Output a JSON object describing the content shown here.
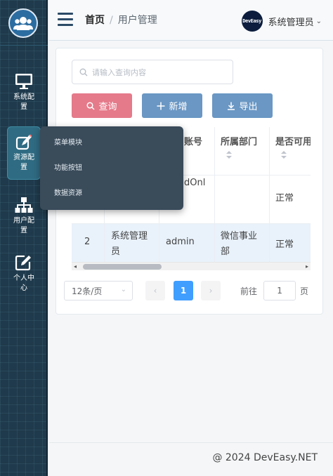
{
  "sidebar": {
    "items": [
      {
        "label": "系统配置",
        "icon": "monitor-icon"
      },
      {
        "label": "资源配置",
        "icon": "pen-icon",
        "active": true
      },
      {
        "label": "用户配置",
        "icon": "org-chart-icon"
      },
      {
        "label": "个人中心",
        "icon": "edit-icon"
      }
    ],
    "submenu": [
      "菜单模块",
      "功能按钮",
      "数据资源"
    ]
  },
  "header": {
    "breadcrumb_home": "首页",
    "breadcrumb_sep": "/",
    "breadcrumb_current": "用户管理",
    "avatar_text": "DevEasy",
    "username": "系统管理员",
    "caret": "⌄"
  },
  "toolbar": {
    "search_placeholder": "请输入查询内容",
    "query_label": "查询",
    "add_label": "新增",
    "export_label": "导出"
  },
  "table": {
    "headers": [
      "账号",
      "所属部门",
      "是否可用"
    ],
    "header_partial": [
      "账号",
      "所属部门",
      "是否可用"
    ],
    "rows": [
      {
        "account": "dOnl",
        "dept": "",
        "status": "正常"
      },
      {
        "no": "2",
        "name": "系统管理员",
        "account": "admin",
        "dept": "微信事业部",
        "status": "正常"
      }
    ]
  },
  "pagination": {
    "page_size": "12条/页",
    "current_page": "1",
    "goto_label": "前往",
    "goto_value": "1",
    "page_suffix": "页"
  },
  "footer": {
    "copyright": "@ 2024 DevEasy.NET"
  },
  "colors": {
    "sidebar": "#1f3a4c",
    "accent": "#54d3df",
    "query_btn": "#e57a8a",
    "action_btn": "#6a97c4",
    "page_active": "#409eff"
  }
}
